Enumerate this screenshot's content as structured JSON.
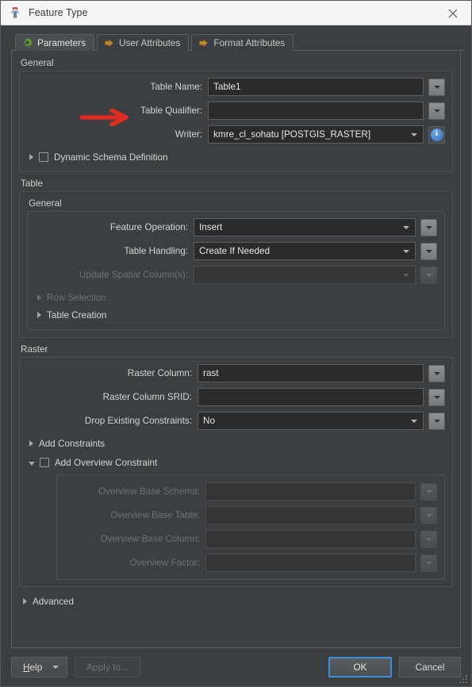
{
  "window": {
    "title": "Feature Type",
    "icon": "feature-type-icon",
    "close_label": "✕"
  },
  "tabs": [
    {
      "label": "Parameters",
      "icon": "gear-icon",
      "active": true
    },
    {
      "label": "User Attributes",
      "icon": "orange-arrow-icon",
      "active": false
    },
    {
      "label": "Format Attributes",
      "icon": "orange-arrow-icon",
      "active": false
    }
  ],
  "general": {
    "title": "General",
    "table_name": {
      "label": "Table Name:",
      "value": "Table1",
      "placeholder": ""
    },
    "table_qualifier": {
      "label": "Table Qualifier:",
      "value": "",
      "placeholder": ""
    },
    "writer": {
      "label": "Writer:",
      "value": "kmre_cl_sohatu [POSTGIS_RASTER]"
    },
    "dynamic_schema": {
      "label": "Dynamic Schema Definition",
      "checked": false,
      "expanded": false
    }
  },
  "table": {
    "title": "Table",
    "general_title": "General",
    "feature_operation": {
      "label": "Feature Operation:",
      "value": "Insert"
    },
    "table_handling": {
      "label": "Table Handling:",
      "value": "Create If Needed"
    },
    "update_spatial_columns": {
      "label": "Update Spatial Column(s):",
      "value": "",
      "disabled": true
    },
    "row_selection": {
      "label": "Row Selection",
      "disabled": true,
      "expanded": false
    },
    "table_creation": {
      "label": "Table Creation",
      "disabled": false,
      "expanded": false
    }
  },
  "raster": {
    "title": "Raster",
    "raster_column": {
      "label": "Raster Column:",
      "value": "rast"
    },
    "raster_column_srid": {
      "label": "Raster Column SRID:",
      "value": ""
    },
    "drop_existing_constraints": {
      "label": "Drop Existing Constraints:",
      "value": "No"
    },
    "add_constraints": {
      "label": "Add Constraints",
      "expanded": false
    },
    "add_overview_constraint": {
      "label": "Add Overview Constraint",
      "checked": false,
      "expanded": true
    },
    "overview_base_schema": {
      "label": "Overview Base Schema:",
      "value": "",
      "disabled": true
    },
    "overview_base_table": {
      "label": "Overview Base Table:",
      "value": "",
      "disabled": true
    },
    "overview_base_column": {
      "label": "Overview Base Column:",
      "value": "",
      "disabled": true
    },
    "overview_factor": {
      "label": "Overview Factor:",
      "value": "",
      "disabled": true
    }
  },
  "advanced": {
    "label": "Advanced",
    "expanded": false
  },
  "footer": {
    "help": {
      "label_mnemonic": "H",
      "label_rest": "elp"
    },
    "apply_to": "Apply to...",
    "ok": "OK",
    "cancel": "Cancel"
  },
  "annotation": {
    "arrow": "red-right-arrow",
    "color": "#e02b20"
  },
  "colors": {
    "window_bg": "#3c3f41",
    "field_bg": "#2b2b2b",
    "accent_blue": "#3a8fd9",
    "tab_active_bg": "#4a4d4f",
    "gear_green": "#5a9b2e",
    "arrow_orange": "#c88a2a"
  }
}
